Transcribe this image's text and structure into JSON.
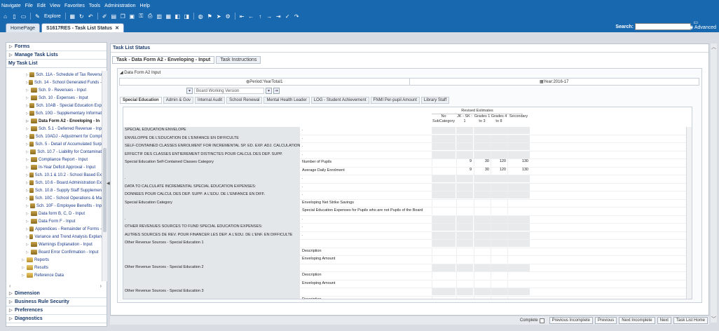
{
  "menu": [
    "Navigate",
    "File",
    "Edit",
    "View",
    "Favorites",
    "Tools",
    "Administration",
    "Help"
  ],
  "toolbar": {
    "explore_label": "Explore"
  },
  "search": {
    "label": "Search:",
    "advanced_label": "Advanced"
  },
  "app_tabs": [
    "HomePage",
    "S1617RES - Task List Status"
  ],
  "left": {
    "top_sections": [
      "Forms",
      "Manage Task Lists"
    ],
    "my_task_list_label": "My Task List",
    "tree_items": [
      {
        "label": "Sch. 11A - Schedule of Tax Revenu",
        "type": "task"
      },
      {
        "label": "Sch. 14 - School Generated Funds -",
        "type": "task"
      },
      {
        "label": "Sch. 9 - Revenues - Input",
        "type": "task"
      },
      {
        "label": "Sch. 10 - Expenses - Input",
        "type": "task"
      },
      {
        "label": "Sch. 10AB - Special Education Exp",
        "type": "task"
      },
      {
        "label": "Sch. 10G - Supplementary Informat",
        "type": "task"
      },
      {
        "label": "Data Form A2 - Enveloping - In",
        "type": "task",
        "selected": true
      },
      {
        "label": "Sch. 5.1 - Deferred Revenue - Inp",
        "type": "task"
      },
      {
        "label": "Sch. 10ADJ - Adjustment for Compl",
        "type": "task"
      },
      {
        "label": "Sch. 5 - Detail of Accumulated Surp",
        "type": "task"
      },
      {
        "label": "Sch. 10.7 - Liability for Contaminat",
        "type": "task"
      },
      {
        "label": "Compliance Report - Input",
        "type": "task"
      },
      {
        "label": "In-Year Deficit Approval - Input",
        "type": "task"
      },
      {
        "label": "Sch. 10.1 & 10.2 - School Based Ex",
        "type": "task"
      },
      {
        "label": "Sch. 10.6 - Board Administration Ex",
        "type": "task"
      },
      {
        "label": "Sch. 10.8 - Supply Staff Supplemen",
        "type": "task"
      },
      {
        "label": "Sch. 10C - School Operations & Ma",
        "type": "task"
      },
      {
        "label": "Sch. 10F - Employee Benefits - Inp",
        "type": "task"
      },
      {
        "label": "Data form B, C, D - Input",
        "type": "task"
      },
      {
        "label": "Data Form F - Input",
        "type": "task"
      },
      {
        "label": "Appendices - Remainder of Forms -",
        "type": "task"
      },
      {
        "label": "Variance and Trend Analysis Explan",
        "type": "task"
      },
      {
        "label": "Warnings Explanation - Input",
        "type": "task"
      },
      {
        "label": "Board Error Confirmation - Input",
        "type": "task"
      },
      {
        "label": "Reports",
        "type": "folder"
      },
      {
        "label": "Results",
        "type": "folder"
      },
      {
        "label": "Reference Data",
        "type": "folder"
      }
    ],
    "bottom_sections": [
      "Dimension",
      "Business Rule Security",
      "Preferences",
      "Diagnostics"
    ]
  },
  "main": {
    "title": "Task List Status",
    "subtabs": [
      "Task - Data Form A2 - Enveloping - Input",
      "Task Instructions"
    ],
    "form_title": "Data Form A2 Input",
    "pov": {
      "period": "Period:YearTotal1",
      "year": "Year:2016-17"
    },
    "page_dropdown": "Board Working Version",
    "grid_tabs": [
      "Special Education",
      "Admin & Gov",
      "Internal Audit",
      "School Renewal",
      "Mental Health Leader",
      "LOG - Student Achievement",
      "FNMI Per-pupil Amount",
      "Library Staff"
    ],
    "grid_header": {
      "group": "Revised Estimates",
      "columns": [
        "No SubCategory",
        "JK - SK : 1",
        "Grades 1 to 3",
        "Grades 4 to 8",
        "Secondary"
      ]
    },
    "rows": [
      {
        "label": "SPECIAL EDUCATION ENVELOPE",
        "sub": ".",
        "vals": []
      },
      {
        "label": "ENVELOPPE DE L'ÉDUCATION DE L'ENFANCE EN DIFFICULTÉ",
        "sub": ".",
        "vals": []
      },
      {
        "label": "SELF-CONTAINED CLASSES ENROLMENT FOR INCREMENTAL SP. ED. EXP. ADJ. CALCULATION:",
        "sub": ".",
        "vals": []
      },
      {
        "label": "EFFECTIF DES CLASSES ENTIÈREMENT DISTINCTES POUR CALCUL DES DÉP. SUPP.",
        "sub": ".",
        "vals": []
      },
      {
        "label": "Special Education Self-Contained Classes Category",
        "sub": "Number of Pupils",
        "vals": [
          "",
          "9",
          "30",
          "120",
          "130"
        ]
      },
      {
        "label": "",
        "sub": "Average Daily Enrolment",
        "vals": [
          "",
          "9",
          "30",
          "120",
          "130"
        ]
      },
      {
        "label": ".",
        "sub": ".",
        "vals": []
      },
      {
        "label": "DATA TO CALCULATE INCREMENTAL SPECIAL EDUCATION EXPENSES:",
        "sub": ".",
        "vals": []
      },
      {
        "label": "DONNÉES POUR CALCUL DES DÉP. SUPP. À L'ÉDU. DE L'ENFANCE EN DIFF.",
        "sub": ".",
        "vals": []
      },
      {
        "label": "Special Education Category",
        "sub": "Enveloping Net Strike Savings",
        "vals": []
      },
      {
        "label": "",
        "sub": "Special Education Expenses for Pupils who are not Pupils of the Board",
        "vals": []
      },
      {
        "label": ".",
        "sub": ".",
        "vals": []
      },
      {
        "label": "OTHER REVENUES SOURCES TO FUND SPECIAL EDUCATION EXPENSES:",
        "sub": ".",
        "vals": []
      },
      {
        "label": "AUTRES SOURCES DE REV. POUR FINANCER LES DÉP. À L'ÉDU. DE L'ENF. EN DIFFICULTÉ",
        "sub": ".",
        "vals": []
      },
      {
        "label": "Other Revenue Sources - Special Education 1",
        "sub": "",
        "vals": []
      },
      {
        "label": "",
        "sub": "Description",
        "vals": []
      },
      {
        "label": "",
        "sub": "Enveloping Amount",
        "vals": []
      },
      {
        "label": "Other Revenue Sources - Special Education 2",
        "sub": "",
        "vals": []
      },
      {
        "label": "",
        "sub": "Description",
        "vals": []
      },
      {
        "label": "",
        "sub": "Enveloping Amount",
        "vals": []
      },
      {
        "label": "Other Revenue Sources - Special Education 3",
        "sub": "",
        "vals": []
      },
      {
        "label": "",
        "sub": "Description",
        "vals": []
      },
      {
        "label": "",
        "sub": "Enveloping Amount",
        "vals": []
      }
    ]
  },
  "footer": {
    "complete_label": "Complete",
    "buttons": [
      "Previous Incomplete",
      "Previous",
      "Next Incomplete",
      "Next",
      "Task List Home"
    ]
  }
}
